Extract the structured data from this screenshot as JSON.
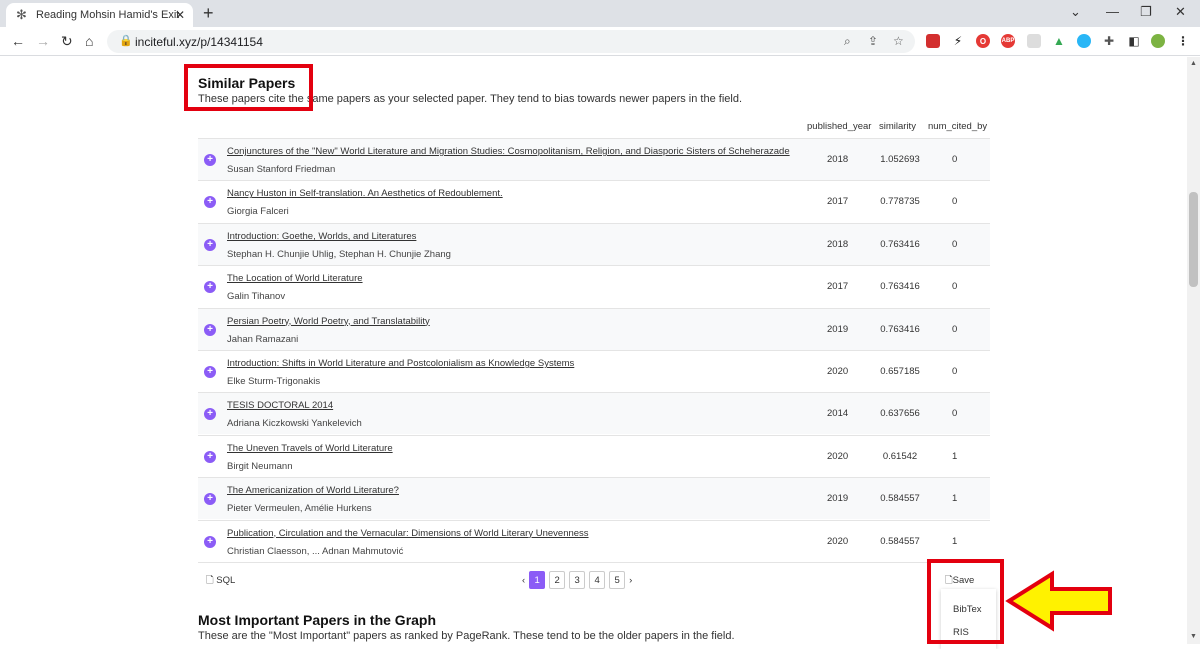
{
  "browser": {
    "tab_title": "Reading Mohsin Hamid's Exit West",
    "url": "inciteful.xyz/p/14341154"
  },
  "similar": {
    "title": "Similar Papers",
    "description": "These papers cite the same papers as your selected paper. They tend to bias towards newer papers in the field.",
    "columns": [
      "published_year",
      "similarity",
      "num_cited_by"
    ],
    "rows": [
      {
        "title": "Conjunctures of the \"New\" World Literature and Migration Studies: Cosmopolitanism, Religion, and Diasporic Sisters of Scheherazade",
        "authors": "Susan Stanford Friedman",
        "year": "2018",
        "similarity": "1.052693",
        "cited": "0"
      },
      {
        "title": "Nancy Huston in Self-translation. An Aesthetics of Redoublement.",
        "authors": "Giorgia Falceri",
        "year": "2017",
        "similarity": "0.778735",
        "cited": "0"
      },
      {
        "title": "Introduction: Goethe, Worlds, and Literatures",
        "authors": "Stephan H. Chunjie Uhlig, Stephan H. Chunjie Zhang",
        "year": "2018",
        "similarity": "0.763416",
        "cited": "0"
      },
      {
        "title": "The Location of World Literature",
        "authors": "Galin Tihanov",
        "year": "2017",
        "similarity": "0.763416",
        "cited": "0"
      },
      {
        "title": "Persian Poetry, World Poetry, and Translatability",
        "authors": "Jahan Ramazani",
        "year": "2019",
        "similarity": "0.763416",
        "cited": "0"
      },
      {
        "title": "Introduction: Shifts in World Literature and Postcolonialism as Knowledge Systems",
        "authors": "Elke Sturm-Trigonakis",
        "year": "2020",
        "similarity": "0.657185",
        "cited": "0"
      },
      {
        "title": "TESIS DOCTORAL 2014",
        "authors": "Adriana Kiczkowski Yankelevich",
        "year": "2014",
        "similarity": "0.637656",
        "cited": "0"
      },
      {
        "title": "The Uneven Travels of World Literature",
        "authors": "Birgit Neumann",
        "year": "2020",
        "similarity": "0.61542",
        "cited": "1"
      },
      {
        "title": "The Americanization of World Literature?",
        "authors": "Pieter Vermeulen, Amélie Hurkens",
        "year": "2019",
        "similarity": "0.584557",
        "cited": "1"
      },
      {
        "title": "Publication, Circulation and the Vernacular: Dimensions of World Literary Unevenness",
        "authors": "Christian Claesson, ... Adnan Mahmutović",
        "year": "2020",
        "similarity": "0.584557",
        "cited": "1"
      }
    ],
    "sql_label": "SQL",
    "pages": [
      "1",
      "2",
      "3",
      "4",
      "5"
    ],
    "save_label": "Save",
    "save_options": [
      "BibTex",
      "RIS"
    ]
  },
  "important": {
    "title": "Most Important Papers in the Graph",
    "description": "These are the \"Most Important\" papers as ranked by PageRank. These tend to be the older papers in the field."
  }
}
